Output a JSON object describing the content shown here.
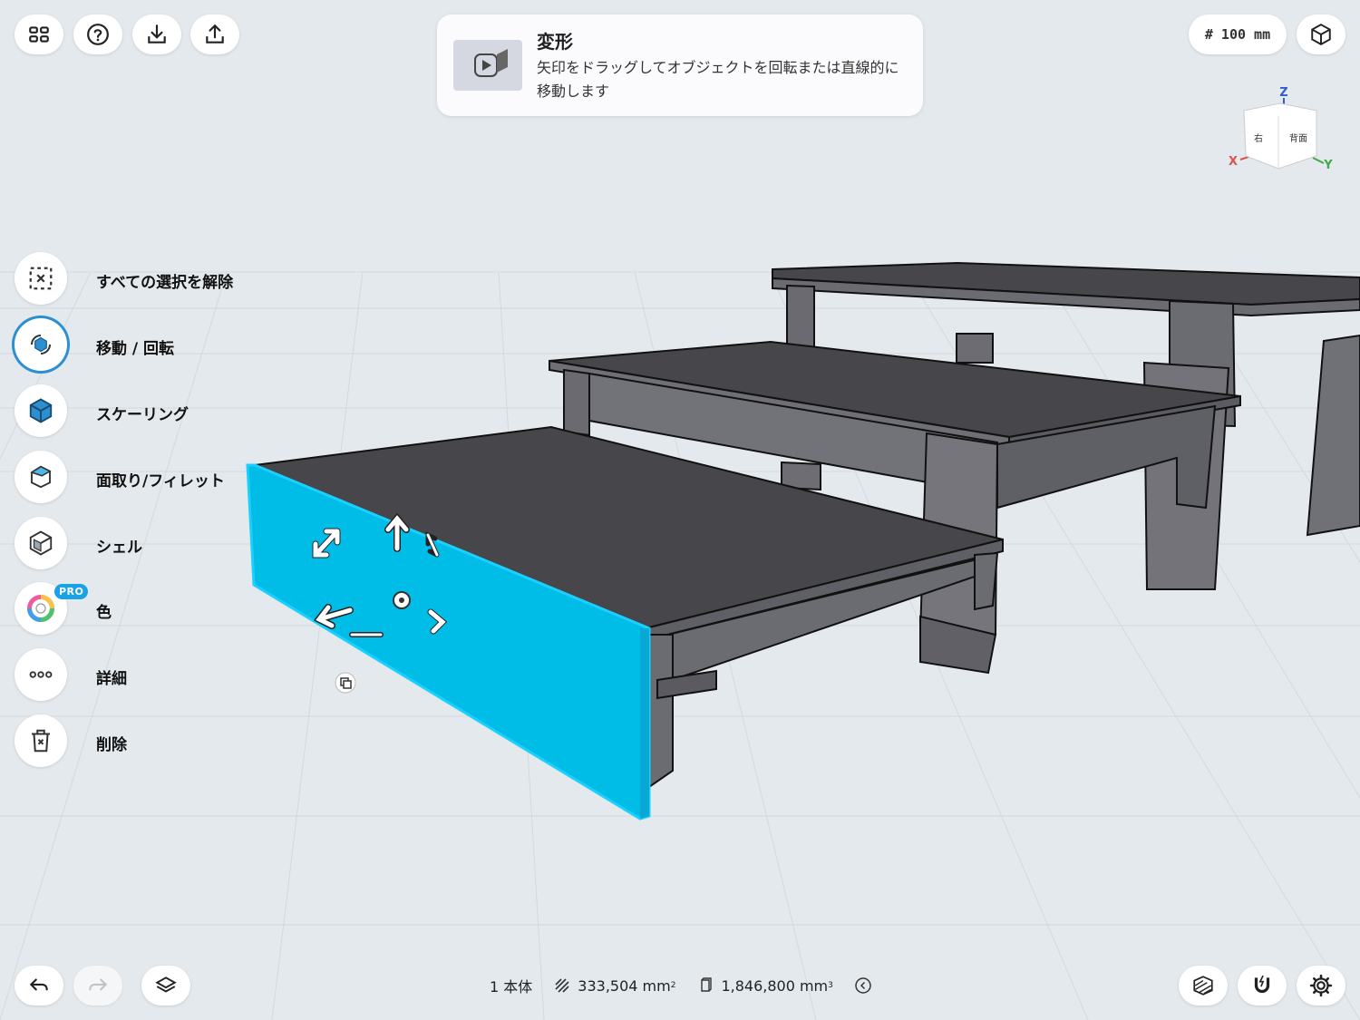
{
  "tip": {
    "title": "変形",
    "text": "矢印をドラッグしてオブジェクトを回転または直線的に移動します"
  },
  "grid": {
    "label": "# 100 mm"
  },
  "view_cube": {
    "z": "Z",
    "x": "X",
    "y": "Y",
    "right": "右",
    "back": "背面"
  },
  "tools": [
    {
      "label": "すべての選択を解除",
      "icon": "deselect-icon"
    },
    {
      "label": "移動 / 回転",
      "icon": "move-rotate-icon"
    },
    {
      "label": "スケーリング",
      "icon": "scale-cube-icon"
    },
    {
      "label": "面取り/フィレット",
      "icon": "fillet-icon"
    },
    {
      "label": "シェル",
      "icon": "shell-icon"
    },
    {
      "label": "色",
      "icon": "color-wheel-icon",
      "badge": "PRO"
    },
    {
      "label": "詳細",
      "icon": "more-dots-icon"
    },
    {
      "label": "削除",
      "icon": "trash-icon"
    }
  ],
  "status": {
    "bodies": "1 本体",
    "area": "333,504 mm",
    "area_exp": "2",
    "volume": "1,846,800 mm",
    "volume_exp": "3"
  },
  "colors": {
    "selection": "#00bde8",
    "accent": "#2b8fd1",
    "table": "#44444a"
  }
}
